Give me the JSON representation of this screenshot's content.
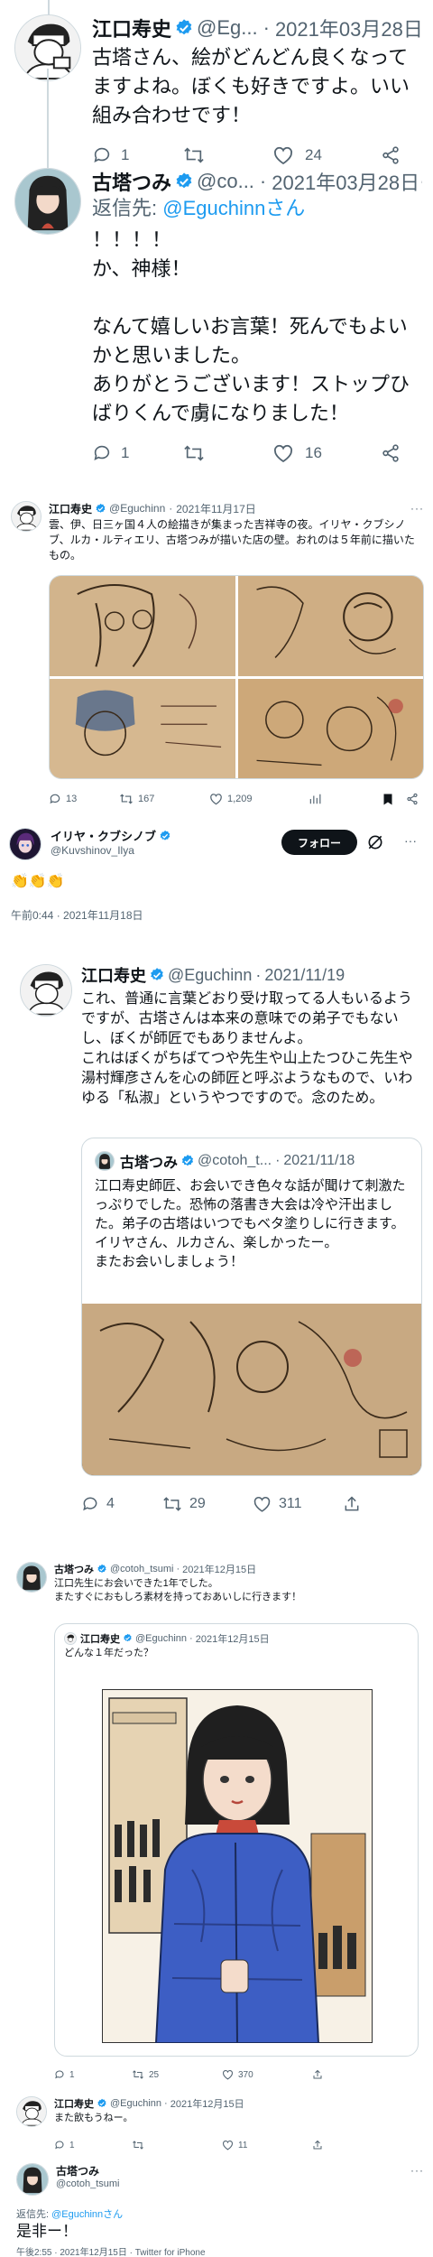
{
  "colors": {
    "accent": "#1d9bf0",
    "text": "#0f1419",
    "muted": "#536471",
    "border": "#cfd9de"
  },
  "s1": {
    "t1": {
      "name": "江口寿史",
      "handle": "@Eg...",
      "date": "2021年03月28日",
      "body": "古塔さん、絵がどんどん良くなってますよね。ぼくも好きですよ。いい組み合わせです！",
      "replies": "1",
      "likes": "24"
    },
    "t2": {
      "name": "古塔つみ",
      "handle": "@co...",
      "date": "2021年03月28日",
      "reply_prefix": "返信先: ",
      "reply_to": "@Eguchinnさん",
      "body": "！！！！\nか、神様！\n\nなんて嬉しいお言葉！死んでもよいかと思いました。\nありがとうございます！ストップひばりくんで虜になりました！",
      "replies": "1",
      "likes": "16"
    }
  },
  "s2": {
    "name": "江口寿史",
    "handle": "@Eguchinn",
    "date": "2021年11月17日",
    "body": "雲、伊、日三ヶ国４人の絵描きが集まった吉祥寺の夜。イリヤ・クブシノブ、ルカ・ルティエリ、古塔つみが描いた店の壁。おれのは５年前に描いたもの。",
    "replies": "13",
    "retweets": "167",
    "likes": "1,209"
  },
  "s3": {
    "name": "イリヤ・クブシノブ",
    "handle": "@Kuvshinov_Ilya",
    "follow_label": "フォロー",
    "body": "👏👏👏",
    "timestamp": "午前0:44 · 2021年11月18日"
  },
  "s4": {
    "name": "江口寿史",
    "handle": "@Eguchinn",
    "date": "2021/11/19",
    "body": "これ、普通に言葉どおり受け取ってる人もいるようですが、古塔さんは本来の意味での弟子でもないし、ぼくが師匠でもありませんよ。\nこれはぼくがちばてつや先生や山上たつひこ先生や湯村輝彦さんを心の師匠と呼ぶようなもので、いわゆる「私淑」というやつですので。念のため。",
    "quote": {
      "name": "古塔つみ",
      "handle": "@cotoh_t...",
      "date": "2021/11/18",
      "body": "江口寿史師匠、お会いでき色々な話が聞けて刺激たっぷりでした。恐怖の落書き大会は冷や汗出ました。弟子の古塔はいつでもベタ塗りしに行きます。\nイリヤさん、ルカさん、楽しかったー。\nまたお会いしましょう！"
    },
    "replies": "4",
    "retweets": "29",
    "likes": "311"
  },
  "s5": {
    "t1": {
      "name": "古塔つみ",
      "handle": "@cotoh_tsumi",
      "date": "2021年12月15日",
      "body": "江口先生にお会いできた1年でした。\nまたすぐにおもしろ素材を持っておあいしに行きます！",
      "quote": {
        "name": "江口寿史",
        "handle": "@Eguchinn",
        "date": "2021年12月15日",
        "body": "どんな１年だった？"
      },
      "replies": "1",
      "retweets": "25",
      "likes": "370"
    },
    "t2": {
      "name": "江口寿史",
      "handle": "@Eguchinn",
      "date": "2021年12月15日",
      "body": "また飲もうねー。",
      "replies": "1",
      "likes": "11"
    },
    "t3": {
      "name": "古塔つみ",
      "handle": "@cotoh_tsumi",
      "reply_prefix": "返信先: ",
      "reply_to": "@Eguchinnさん",
      "body": "是非ー！",
      "timestamp": "午後2:55 · 2021年12月15日 · Twitter for iPhone"
    }
  }
}
